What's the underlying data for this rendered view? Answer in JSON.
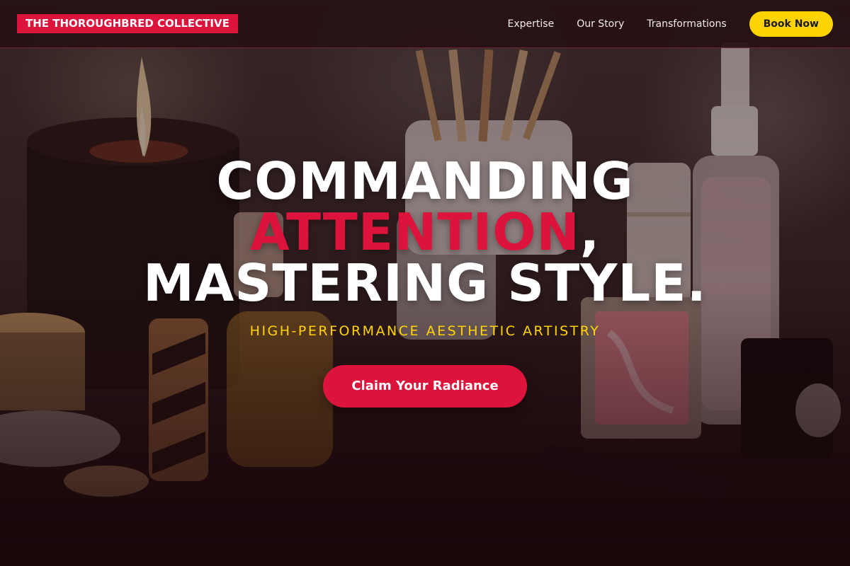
{
  "nav": {
    "logo": "THE THOROUGHBRED COLLECTIVE",
    "links": [
      "Expertise",
      "Our Story",
      "Transformations"
    ],
    "book_label": "Book Now"
  },
  "hero": {
    "headline_line1": "COMMANDING",
    "headline_accent": "ATTENTION",
    "headline_comma": ",",
    "headline_line3": "MASTERING STYLE.",
    "tagline": "HIGH-PERFORMANCE AESTHETIC ARTISTRY",
    "cta_label": "Claim Your Radiance"
  },
  "colors": {
    "brand_red": "#dc143c",
    "accent_yellow": "#ffd400",
    "nav_bg": "#26101a"
  },
  "icons": {
    "background": "cosmetics-vanity-photo"
  }
}
